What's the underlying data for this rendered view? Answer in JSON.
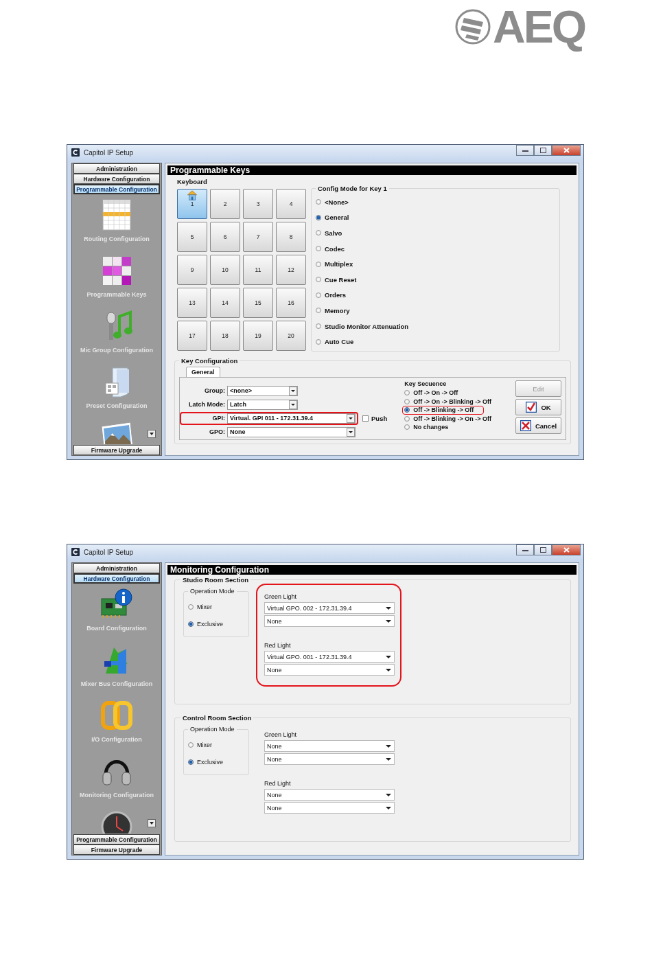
{
  "logo": {
    "text": "AEQ"
  },
  "windows": [
    {
      "title": "Capitol IP Setup",
      "sidebar": {
        "top_buttons": [
          {
            "label": "Administration",
            "selected": false
          },
          {
            "label": "Hardware Configuration",
            "selected": false
          },
          {
            "label": "Programmable Configuration",
            "selected": true
          }
        ],
        "items": [
          {
            "label": "Routing Configuration"
          },
          {
            "label": "Programmable Keys"
          },
          {
            "label": "Mic Group Configuration"
          },
          {
            "label": "Preset Configuration"
          },
          {
            "cut_off": true
          }
        ],
        "scroll_button": true,
        "bottom_buttons": [
          {
            "label": "Firmware Upgrade",
            "selected": false
          }
        ]
      },
      "panel": {
        "kind": "keys",
        "title": "Programmable Keys",
        "keyboard": {
          "title": "Keyboard",
          "keys": [
            {
              "label": "1",
              "selected": true,
              "configured": true
            },
            {
              "label": "2",
              "selected": false,
              "configured": false
            },
            {
              "label": "3",
              "selected": false,
              "configured": false
            },
            {
              "label": "4",
              "selected": false,
              "configured": false
            },
            {
              "label": "5",
              "selected": false,
              "configured": false
            },
            {
              "label": "6",
              "selected": false,
              "configured": false
            },
            {
              "label": "7",
              "selected": false,
              "configured": false
            },
            {
              "label": "8",
              "selected": false,
              "configured": false
            },
            {
              "label": "9",
              "selected": false,
              "configured": false
            },
            {
              "label": "10",
              "selected": false,
              "configured": false
            },
            {
              "label": "11",
              "selected": false,
              "configured": false
            },
            {
              "label": "12",
              "selected": false,
              "configured": false
            },
            {
              "label": "13",
              "selected": false,
              "configured": false
            },
            {
              "label": "14",
              "selected": false,
              "configured": false
            },
            {
              "label": "15",
              "selected": false,
              "configured": false
            },
            {
              "label": "16",
              "selected": false,
              "configured": false
            },
            {
              "label": "17",
              "selected": false,
              "configured": false
            },
            {
              "label": "18",
              "selected": false,
              "configured": false
            },
            {
              "label": "19",
              "selected": false,
              "configured": false
            },
            {
              "label": "20",
              "selected": false,
              "configured": false
            }
          ]
        },
        "config_mode": {
          "title": "Config Mode for Key 1",
          "options": [
            {
              "label": "<None>",
              "selected": false
            },
            {
              "label": "General",
              "selected": true
            },
            {
              "label": "Salvo",
              "selected": false
            },
            {
              "label": "Codec",
              "selected": false
            },
            {
              "label": "Multiplex",
              "selected": false
            },
            {
              "label": "Cue Reset",
              "selected": false
            },
            {
              "label": "Orders",
              "selected": false
            },
            {
              "label": "Memory",
              "selected": false
            },
            {
              "label": "Studio Monitor Attenuation",
              "selected": false
            },
            {
              "label": "Auto Cue",
              "selected": false
            }
          ]
        },
        "key_configuration": {
          "title": "Key Configuration",
          "tabs": [
            {
              "label": "General",
              "selected": true
            }
          ],
          "fields": [
            {
              "label": "Group:",
              "value": "<none>",
              "highlighted": false
            },
            {
              "label": "Latch Mode:",
              "value": "Latch",
              "highlighted": false
            },
            {
              "label": "GPI:",
              "value": "Virtual. GPI 011 - 172.31.39.4",
              "highlighted": true,
              "checkbox": {
                "label": "Push",
                "checked": false
              }
            },
            {
              "label": "GPO:",
              "value": "None",
              "highlighted": false
            }
          ],
          "key_sequence": {
            "title": "Key Secuence",
            "options": [
              {
                "label": "Off -> On -> Off",
                "selected": false,
                "highlighted": false
              },
              {
                "label": "Off -> On -> Blinking -> Off",
                "selected": false,
                "highlighted": false
              },
              {
                "label": "Off -> Blinking -> Off",
                "selected": true,
                "highlighted": true
              },
              {
                "label": "Off -> Blinking -> On -> Off",
                "selected": false,
                "highlighted": false
              },
              {
                "label": "No changes",
                "selected": false,
                "highlighted": false
              }
            ]
          },
          "buttons": [
            {
              "label": "Edit",
              "kind": "edit",
              "disabled": true
            },
            {
              "label": "OK",
              "kind": "ok",
              "disabled": false
            },
            {
              "label": "Cancel",
              "kind": "cancel",
              "disabled": false
            }
          ]
        }
      }
    },
    {
      "title": "Capitol IP Setup",
      "sidebar": {
        "top_buttons": [
          {
            "label": "Administration",
            "selected": false
          },
          {
            "label": "Hardware Configuration",
            "selected": true
          }
        ],
        "items": [
          {
            "label": "Board Configuration"
          },
          {
            "label": "Mixer Bus Configuration"
          },
          {
            "label": "I/O Configuration"
          },
          {
            "label": "Monitoring Configuration"
          },
          {
            "cut_off": true
          }
        ],
        "scroll_button": true,
        "bottom_buttons": [
          {
            "label": "Programmable Configuration",
            "selected": false
          },
          {
            "label": "Firmware Upgrade",
            "selected": false
          }
        ]
      },
      "panel": {
        "kind": "monitoring",
        "title": "Monitoring Configuration",
        "sections": [
          {
            "title": "Studio Room Section",
            "highlighted": true,
            "operation_mode": {
              "title": "Operation Mode",
              "options": [
                {
                  "label": "Mixer",
                  "selected": false
                },
                {
                  "label": "Exclusive",
                  "selected": true
                }
              ]
            },
            "lights": [
              {
                "label": "Green Light",
                "values": [
                  "Virtual GPO. 002 - 172.31.39.4",
                  "None"
                ]
              },
              {
                "label": "Red Light",
                "values": [
                  "Virtual GPO. 001 - 172.31.39.4",
                  "None"
                ]
              }
            ]
          },
          {
            "title": "Control Room Section",
            "highlighted": false,
            "operation_mode": {
              "title": "Operation Mode",
              "options": [
                {
                  "label": "Mixer",
                  "selected": false
                },
                {
                  "label": "Exclusive",
                  "selected": true
                }
              ]
            },
            "lights": [
              {
                "label": "Green Light",
                "values": [
                  "None",
                  "None"
                ]
              },
              {
                "label": "Red Light",
                "values": [
                  "None",
                  "None"
                ]
              }
            ]
          }
        ]
      }
    }
  ]
}
